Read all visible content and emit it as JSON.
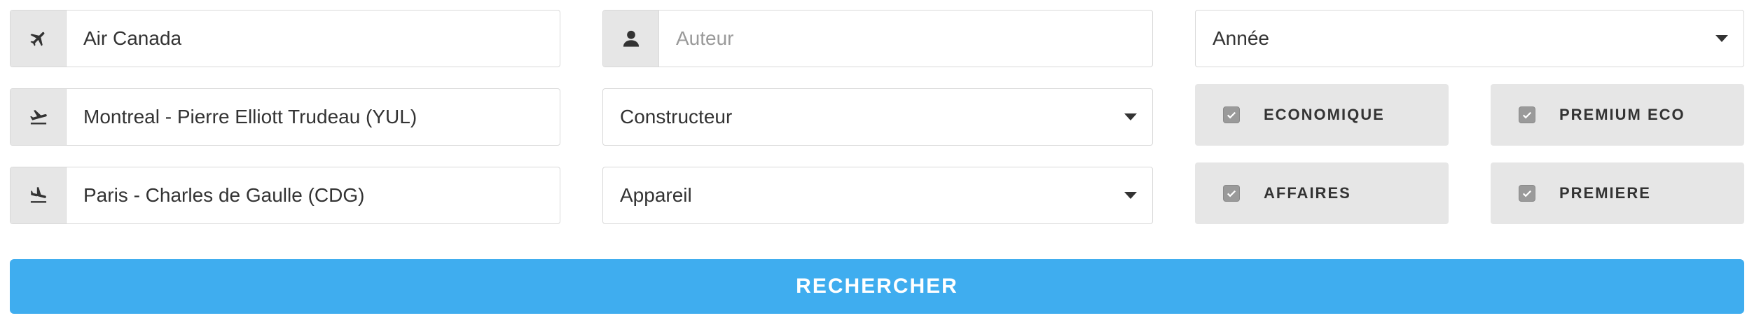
{
  "airline": {
    "value": "Air Canada",
    "icon": "plane-icon"
  },
  "author": {
    "placeholder": "Auteur",
    "icon": "user-icon"
  },
  "year": {
    "selected": "Année"
  },
  "departure": {
    "value": "Montreal - Pierre Elliott Trudeau  (YUL)",
    "icon": "takeoff-icon"
  },
  "manufacturer": {
    "selected": "Constructeur"
  },
  "arrival": {
    "value": "Paris - Charles de Gaulle (CDG)",
    "icon": "landing-icon"
  },
  "aircraft": {
    "selected": "Appareil"
  },
  "cabins": [
    {
      "label": "ECONOMIQUE",
      "checked": true
    },
    {
      "label": "PREMIUM ECO",
      "checked": true
    },
    {
      "label": "AFFAIRES",
      "checked": true
    },
    {
      "label": "PREMIERE",
      "checked": true
    }
  ],
  "search_button": {
    "label": "RECHERCHER"
  },
  "colors": {
    "accent": "#3fadef",
    "addon_bg": "#e6e6e6",
    "border": "#d9d9d9",
    "text": "#333333"
  }
}
